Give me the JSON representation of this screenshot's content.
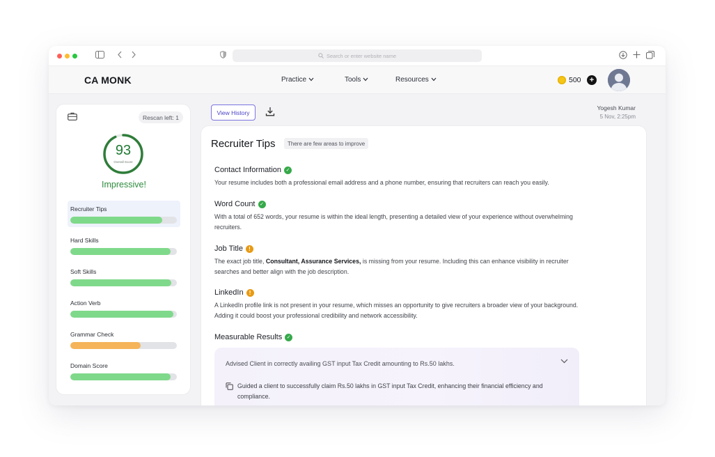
{
  "browser": {
    "url_placeholder": "Search or enter website name"
  },
  "nav": {
    "logo": "CA MONK",
    "menu": [
      {
        "label": "Practice"
      },
      {
        "label": "Tools"
      },
      {
        "label": "Resources"
      }
    ],
    "coins": "500",
    "coin_add": "+"
  },
  "left": {
    "rescan": "Rescan left: 1",
    "score": "93",
    "score_label": "Overall Score",
    "score_fraction": 0.93,
    "verdict": "Impressive!",
    "categories": [
      {
        "label": "Recruiter Tips",
        "progress": 0.86,
        "color": "#7fd98a",
        "active": true
      },
      {
        "label": "Hard Skills",
        "progress": 0.94,
        "color": "#7fd98a",
        "active": false
      },
      {
        "label": "Soft Skills",
        "progress": 0.95,
        "color": "#7fd98a",
        "active": false
      },
      {
        "label": "Action Verb",
        "progress": 0.97,
        "color": "#7fd98a",
        "active": false
      },
      {
        "label": "Grammar Check",
        "progress": 0.66,
        "color": "#f5b45a",
        "active": false
      },
      {
        "label": "Domain Score",
        "progress": 0.94,
        "color": "#7fd98a",
        "active": false
      }
    ]
  },
  "toolbar": {
    "view_history": "View History",
    "user_name": "Yogesh Kumar",
    "user_date": "5 Nov, 2:25pm"
  },
  "main": {
    "title": "Recruiter Tips",
    "hint": "There are few areas to improve",
    "sections": [
      {
        "title": "Contact Information",
        "status": "ok",
        "body": "Your resume includes both a professional email address and a phone number, ensuring that recruiters can reach you easily."
      },
      {
        "title": "Word Count",
        "status": "ok",
        "body": "With a total of 652 words, your resume is within the ideal length, presenting a detailed view of your experience without overwhelming recruiters."
      },
      {
        "title": "Job Title",
        "status": "warn",
        "body_pre": "The exact job title, ",
        "body_bold": "Consultant, Assurance Services,",
        "body_post": " is missing from your resume. Including this can enhance visibility in recruiter searches and better align with the job description."
      },
      {
        "title": "LinkedIn",
        "status": "warn",
        "body": "A LinkedIn profile link is not present in your resume, which misses an opportunity to give recruiters a broader view of your background. Adding it could boost your professional credibility and network accessibility."
      },
      {
        "title": "Measurable Results",
        "status": "ok"
      }
    ],
    "result_card": {
      "heading": "Advised Client in correctly availing GST input Tax Credit amounting to Rs.50 lakhs.",
      "line": "Guided a client to successfully claim Rs.50 lakhs in GST input Tax Credit, enhancing their financial efficiency and compliance."
    }
  },
  "colors": {
    "accent": "#5b54d6",
    "success": "#36a94a",
    "warning": "#e89a14",
    "gauge": "#2f7d3a"
  }
}
